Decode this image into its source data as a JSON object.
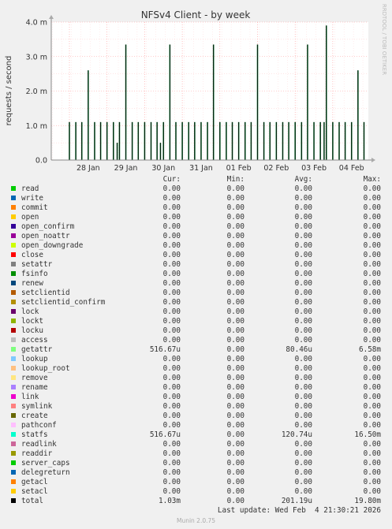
{
  "chart_data": {
    "type": "line",
    "title": "NFSv4 Client - by week",
    "ylabel": "requests / second",
    "yticks": [
      "0.0",
      "1.0 m",
      "2.0 m",
      "3.0 m",
      "4.0 m"
    ],
    "ylim": [
      0,
      4.0
    ],
    "y_unit": "m",
    "xticks": [
      "28 Jan",
      "29 Jan",
      "30 Jan",
      "31 Jan",
      "01 Feb",
      "02 Feb",
      "03 Feb",
      "04 Feb"
    ],
    "grid": true,
    "watermark": "RRDTOOL / TOBI OETIKER",
    "series": [
      {
        "name": "total",
        "color": "#000000",
        "peaks_day": [
          [
            0.0,
            1.1
          ],
          [
            0.17,
            1.1
          ],
          [
            0.33,
            1.1
          ],
          [
            0.5,
            2.6
          ],
          [
            0.67,
            1.1
          ],
          [
            0.83,
            1.1
          ],
          [
            1.0,
            1.1
          ],
          [
            1.17,
            1.1
          ],
          [
            1.27,
            0.5
          ],
          [
            1.33,
            1.1
          ],
          [
            1.5,
            3.35
          ],
          [
            1.67,
            1.1
          ],
          [
            1.83,
            1.1
          ],
          [
            2.0,
            1.1
          ],
          [
            2.17,
            1.1
          ],
          [
            2.33,
            1.1
          ],
          [
            2.42,
            0.5
          ],
          [
            2.5,
            1.1
          ],
          [
            2.67,
            3.35
          ],
          [
            2.83,
            1.1
          ],
          [
            3.0,
            1.1
          ],
          [
            3.17,
            1.1
          ],
          [
            3.33,
            1.1
          ],
          [
            3.5,
            1.1
          ],
          [
            3.67,
            1.1
          ],
          [
            3.83,
            3.35
          ],
          [
            4.0,
            1.1
          ],
          [
            4.17,
            1.1
          ],
          [
            4.33,
            1.1
          ],
          [
            4.5,
            1.1
          ],
          [
            4.67,
            1.1
          ],
          [
            4.83,
            1.1
          ],
          [
            5.0,
            3.35
          ],
          [
            5.17,
            1.1
          ],
          [
            5.33,
            1.1
          ],
          [
            5.5,
            1.1
          ],
          [
            5.67,
            1.1
          ],
          [
            5.83,
            1.1
          ],
          [
            6.0,
            1.1
          ],
          [
            6.17,
            1.1
          ],
          [
            6.33,
            3.35
          ],
          [
            6.5,
            1.1
          ],
          [
            6.67,
            1.1
          ],
          [
            6.77,
            1.1
          ],
          [
            6.83,
            3.9
          ],
          [
            7.0,
            1.1
          ],
          [
            7.17,
            1.1
          ],
          [
            7.33,
            1.1
          ],
          [
            7.5,
            1.1
          ],
          [
            7.67,
            2.6
          ],
          [
            7.83,
            1.1
          ],
          [
            8.0,
            1.1
          ],
          [
            8.17,
            1.1
          ],
          [
            8.33,
            1.1
          ],
          [
            8.5,
            1.1
          ],
          [
            8.67,
            1.1
          ],
          [
            8.83,
            3.35
          ],
          [
            9.0,
            1.1
          ],
          [
            9.17,
            1.05
          ],
          [
            9.33,
            1.05
          ],
          [
            9.5,
            1.05
          ]
        ]
      }
    ]
  },
  "legend": {
    "headers": {
      "cur": "Cur:",
      "min": "Min:",
      "avg": "Avg:",
      "max": "Max:"
    },
    "rows": [
      {
        "name": "read",
        "color": "#00cc00",
        "cur": "0.00",
        "min": "0.00",
        "avg": "0.00",
        "max": "0.00"
      },
      {
        "name": "write",
        "color": "#0066b3",
        "cur": "0.00",
        "min": "0.00",
        "avg": "0.00",
        "max": "0.00"
      },
      {
        "name": "commit",
        "color": "#ff8000",
        "cur": "0.00",
        "min": "0.00",
        "avg": "0.00",
        "max": "0.00"
      },
      {
        "name": "open",
        "color": "#ffcc00",
        "cur": "0.00",
        "min": "0.00",
        "avg": "0.00",
        "max": "0.00"
      },
      {
        "name": "open_confirm",
        "color": "#330099",
        "cur": "0.00",
        "min": "0.00",
        "avg": "0.00",
        "max": "0.00"
      },
      {
        "name": "open_noattr",
        "color": "#990099",
        "cur": "0.00",
        "min": "0.00",
        "avg": "0.00",
        "max": "0.00"
      },
      {
        "name": "open_downgrade",
        "color": "#ccff00",
        "cur": "0.00",
        "min": "0.00",
        "avg": "0.00",
        "max": "0.00"
      },
      {
        "name": "close",
        "color": "#ff0000",
        "cur": "0.00",
        "min": "0.00",
        "avg": "0.00",
        "max": "0.00"
      },
      {
        "name": "setattr",
        "color": "#808080",
        "cur": "0.00",
        "min": "0.00",
        "avg": "0.00",
        "max": "0.00"
      },
      {
        "name": "fsinfo",
        "color": "#008f00",
        "cur": "0.00",
        "min": "0.00",
        "avg": "0.00",
        "max": "0.00"
      },
      {
        "name": "renew",
        "color": "#00487d",
        "cur": "0.00",
        "min": "0.00",
        "avg": "0.00",
        "max": "0.00"
      },
      {
        "name": "setclientid",
        "color": "#b35a00",
        "cur": "0.00",
        "min": "0.00",
        "avg": "0.00",
        "max": "0.00"
      },
      {
        "name": "setclientid_confirm",
        "color": "#b38f00",
        "cur": "0.00",
        "min": "0.00",
        "avg": "0.00",
        "max": "0.00"
      },
      {
        "name": "lock",
        "color": "#6b006b",
        "cur": "0.00",
        "min": "0.00",
        "avg": "0.00",
        "max": "0.00"
      },
      {
        "name": "lockt",
        "color": "#8fb300",
        "cur": "0.00",
        "min": "0.00",
        "avg": "0.00",
        "max": "0.00"
      },
      {
        "name": "locku",
        "color": "#b30000",
        "cur": "0.00",
        "min": "0.00",
        "avg": "0.00",
        "max": "0.00"
      },
      {
        "name": "access",
        "color": "#bebebe",
        "cur": "0.00",
        "min": "0.00",
        "avg": "0.00",
        "max": "0.00"
      },
      {
        "name": "getattr",
        "color": "#80ff80",
        "cur": "516.67u",
        "min": "0.00",
        "avg": "80.46u",
        "max": "6.58m"
      },
      {
        "name": "lookup",
        "color": "#80c9ff",
        "cur": "0.00",
        "min": "0.00",
        "avg": "0.00",
        "max": "0.00"
      },
      {
        "name": "lookup_root",
        "color": "#ffc080",
        "cur": "0.00",
        "min": "0.00",
        "avg": "0.00",
        "max": "0.00"
      },
      {
        "name": "remove",
        "color": "#ffe680",
        "cur": "0.00",
        "min": "0.00",
        "avg": "0.00",
        "max": "0.00"
      },
      {
        "name": "rename",
        "color": "#aa80ff",
        "cur": "0.00",
        "min": "0.00",
        "avg": "0.00",
        "max": "0.00"
      },
      {
        "name": "link",
        "color": "#ee00cc",
        "cur": "0.00",
        "min": "0.00",
        "avg": "0.00",
        "max": "0.00"
      },
      {
        "name": "symlink",
        "color": "#ff8080",
        "cur": "0.00",
        "min": "0.00",
        "avg": "0.00",
        "max": "0.00"
      },
      {
        "name": "create",
        "color": "#666600",
        "cur": "0.00",
        "min": "0.00",
        "avg": "0.00",
        "max": "0.00"
      },
      {
        "name": "pathconf",
        "color": "#ffbfff",
        "cur": "0.00",
        "min": "0.00",
        "avg": "0.00",
        "max": "0.00"
      },
      {
        "name": "statfs",
        "color": "#00ffcc",
        "cur": "516.67u",
        "min": "0.00",
        "avg": "120.74u",
        "max": "16.50m"
      },
      {
        "name": "readlink",
        "color": "#cc6699",
        "cur": "0.00",
        "min": "0.00",
        "avg": "0.00",
        "max": "0.00"
      },
      {
        "name": "readdir",
        "color": "#999900",
        "cur": "0.00",
        "min": "0.00",
        "avg": "0.00",
        "max": "0.00"
      },
      {
        "name": "server_caps",
        "color": "#00cc00",
        "cur": "0.00",
        "min": "0.00",
        "avg": "0.00",
        "max": "0.00"
      },
      {
        "name": "delegreturn",
        "color": "#0066b3",
        "cur": "0.00",
        "min": "0.00",
        "avg": "0.00",
        "max": "0.00"
      },
      {
        "name": "getacl",
        "color": "#ff8000",
        "cur": "0.00",
        "min": "0.00",
        "avg": "0.00",
        "max": "0.00"
      },
      {
        "name": "setacl",
        "color": "#ffcc00",
        "cur": "0.00",
        "min": "0.00",
        "avg": "0.00",
        "max": "0.00"
      },
      {
        "name": "total",
        "color": "#000000",
        "cur": "1.03m",
        "min": "0.00",
        "avg": "201.19u",
        "max": "19.80m"
      }
    ]
  },
  "footer": {
    "last_update": "Last update: Wed Feb  4 21:30:21 2026",
    "munin_version": "Munin 2.0.75"
  }
}
